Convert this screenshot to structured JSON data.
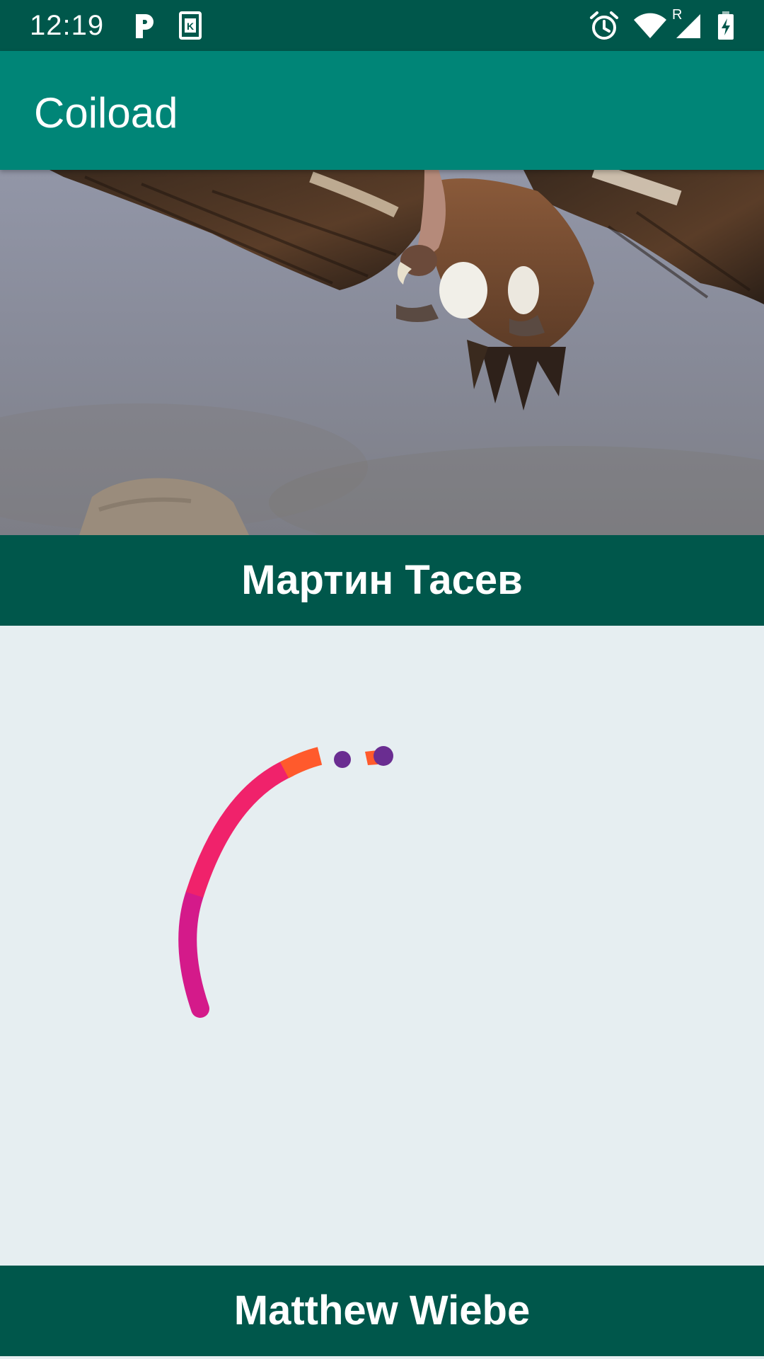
{
  "status_bar": {
    "time": "12:19",
    "icons": [
      "p-notification-icon",
      "k-notification-icon",
      "alarm-icon",
      "wifi-icon",
      "signal-roaming-icon",
      "battery-charging-icon"
    ],
    "roaming_label": "R"
  },
  "app_bar": {
    "title": "Coiload"
  },
  "list": {
    "items": [
      {
        "caption": "Мартин Тасев",
        "image": "vulture-in-flight-photo"
      },
      {
        "caption": "Matthew Wiebe",
        "image": "loading-spinner"
      }
    ]
  },
  "colors": {
    "status_bar": "#00574b",
    "app_bar": "#008577",
    "caption_bar": "#00574b",
    "spinner_magenta": "#d41a8a",
    "spinner_pink": "#f0226b",
    "spinner_orange": "#ff5a2c",
    "spinner_purple": "#6a2d91"
  }
}
